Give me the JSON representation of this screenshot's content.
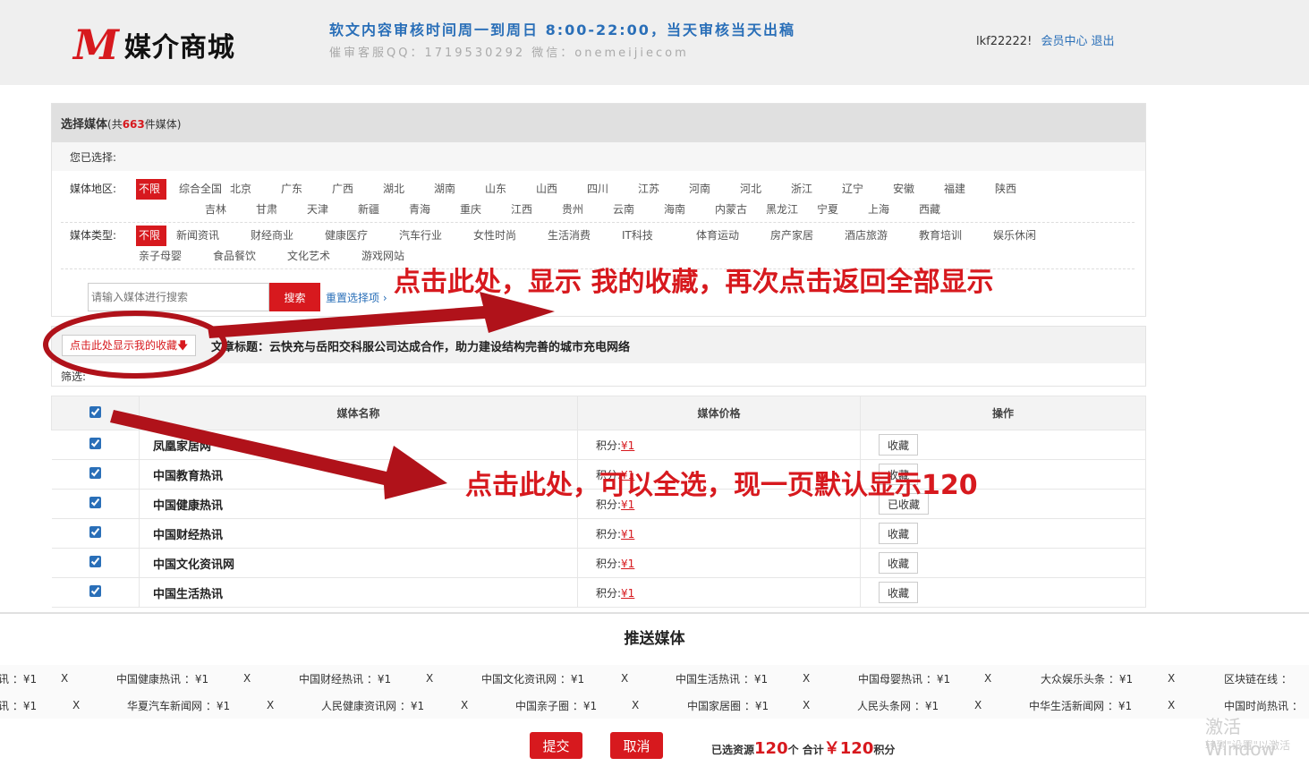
{
  "header": {
    "logo_mark": "M",
    "logo_text": "媒介商城",
    "notice_line1": "软文内容审核时间周一到周日 8:00-22:00，当天审核当天出稿",
    "notice_line2": "催审客服QQ：1719530292  微信：onemeijiecom",
    "username": "lkf22222!",
    "member_center": "会员中心",
    "logout": "退出"
  },
  "filter": {
    "title": "选择媒体",
    "count_prefix": "(共",
    "count": "663",
    "count_suffix": "件媒体)",
    "chosen_label": "您已选择:",
    "region_label": "媒体地区:",
    "regions": [
      "不限",
      "综合全国",
      "北京",
      "广东",
      "广西",
      "湖北",
      "湖南",
      "山东",
      "山西",
      "四川",
      "江苏",
      "河南",
      "河北",
      "浙江",
      "辽宁",
      "安徽",
      "福建",
      "陕西",
      "吉林",
      "甘肃",
      "天津",
      "新疆",
      "青海",
      "重庆",
      "江西",
      "贵州",
      "云南",
      "海南",
      "内蒙古",
      "黑龙江",
      "宁夏",
      "上海",
      "西藏"
    ],
    "type_label": "媒体类型:",
    "types": [
      "不限",
      "新闻资讯",
      "财经商业",
      "健康医疗",
      "汽车行业",
      "女性时尚",
      "生活消费",
      "IT科技",
      "体育运动",
      "房产家居",
      "酒店旅游",
      "教育培训",
      "娱乐休闲",
      "亲子母婴",
      "食品餐饮",
      "文化艺术",
      "游戏网站"
    ],
    "search_placeholder": "请输入媒体进行搜索",
    "search_button": "搜索",
    "reset": "重置选择项 ›"
  },
  "article": {
    "fav_button": "点击此处显示我的收藏🡇",
    "title": "文章标题：云快充与岳阳交科服公司达成合作，助力建设结构完善的城市充电网络",
    "screening": "筛选:"
  },
  "table": {
    "headers": [
      "媒体名称",
      "媒体价格",
      "操作"
    ],
    "price_label": "积分:",
    "rows": [
      {
        "name": "凤凰家居网",
        "price": "¥1",
        "op": "收藏"
      },
      {
        "name": "中国教育热讯",
        "price": "¥1",
        "op": "收藏"
      },
      {
        "name": "中国健康热讯",
        "price": "¥1",
        "op": "已收藏"
      },
      {
        "name": "中国财经热讯",
        "price": "¥1",
        "op": "收藏"
      },
      {
        "name": "中国文化资讯网",
        "price": "¥1",
        "op": "收藏"
      },
      {
        "name": "中国生活热讯",
        "price": "¥1",
        "op": "收藏"
      }
    ]
  },
  "bottom": {
    "title": "推送媒体",
    "row1": [
      "讯 ：¥1",
      "中国健康热讯 ：¥1",
      "中国财经热讯 ：¥1",
      "中国文化资讯网 ：¥1",
      "中国生活热讯 ：¥1",
      "中国母婴热讯 ：¥1",
      "大众娱乐头条 ：¥1",
      "区块链在线 ："
    ],
    "row2": [
      "讯 ：¥1",
      "华夏汽车新闻网 ：¥1",
      "人民健康资讯网 ：¥1",
      "中国亲子圈 ：¥1",
      "中国家居圈 ：¥1",
      "人民头条网 ：¥1",
      "中华生活新闻网 ：¥1",
      "中国时尚热讯 ："
    ],
    "remove": "X",
    "submit": "提交",
    "cancel": "取消",
    "summary_prefix": "已选资源",
    "summary_count": "120",
    "summary_mid": "个 合计",
    "summary_total": "￥120",
    "summary_suffix": "积分",
    "watermark1": "激活 Window",
    "watermark2": "转到\"设置\"以激活"
  },
  "annotations": {
    "top": "点击此处，显示 我的收藏，再次点击返回全部显示",
    "mid": "点击此处，可以全选，现一页默认显示120"
  },
  "colors": {
    "accent": "#d7191e",
    "link": "#2a6fb8"
  }
}
